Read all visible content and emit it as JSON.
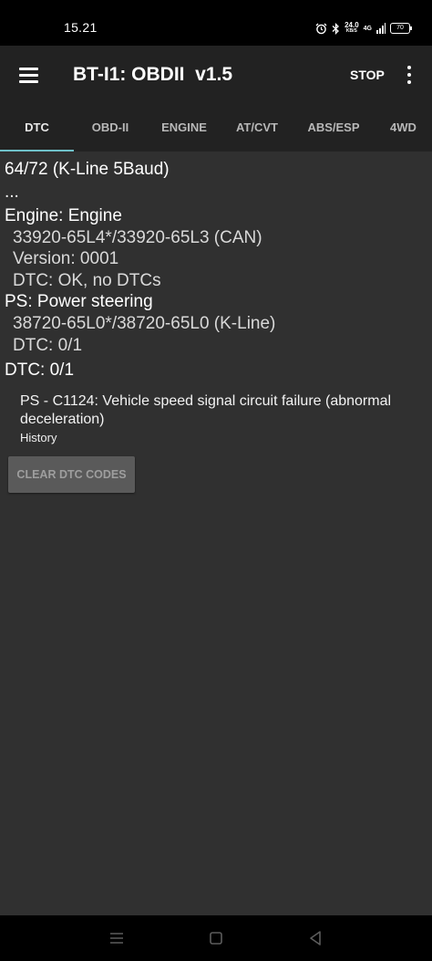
{
  "status_bar": {
    "time": "15.21",
    "speed_value": "24.0",
    "speed_unit": "KB/S",
    "network": "4G",
    "battery": "70",
    "icons": [
      "alarm-icon",
      "bluetooth-icon",
      "signal-icon",
      "battery-icon"
    ]
  },
  "app_bar": {
    "title": "BT-I1: OBDII  v1.5",
    "stop_label": "STOP",
    "menu_icon": "hamburger-menu-icon",
    "overflow_icon": "more-vert-icon"
  },
  "tabs": [
    {
      "label": "DTC",
      "active": true
    },
    {
      "label": "OBD-II",
      "active": false
    },
    {
      "label": "ENGINE",
      "active": false
    },
    {
      "label": "AT/CVT",
      "active": false
    },
    {
      "label": "ABS/ESP",
      "active": false
    },
    {
      "label": "4WD",
      "active": false
    }
  ],
  "content": {
    "progress": "64/72 (K-Line 5Baud)",
    "ellipsis": "...",
    "engine": {
      "header": "Engine: Engine",
      "part_number": "33920-65L4*/33920-65L3 (CAN)",
      "version": "Version: 0001",
      "dtc": "DTC: OK, no DTCs"
    },
    "ps": {
      "header": "PS: Power steering",
      "part_number": "38720-65L0*/38720-65L0 (K-Line)",
      "dtc": "DTC: 0/1"
    },
    "dtc_total": "DTC: 0/1",
    "dtc_entry": {
      "description": "PS - C1124: Vehicle speed signal circuit failure (abnormal deceleration)",
      "status": "History"
    },
    "clear_button": "CLEAR DTC CODES"
  },
  "nav_bar": {
    "icons": [
      "recents-icon",
      "home-icon",
      "back-icon"
    ]
  },
  "colors": {
    "background": "#303030",
    "app_bar": "#222222",
    "accent": "#6fc1c9",
    "button": "#5a5a5a"
  }
}
